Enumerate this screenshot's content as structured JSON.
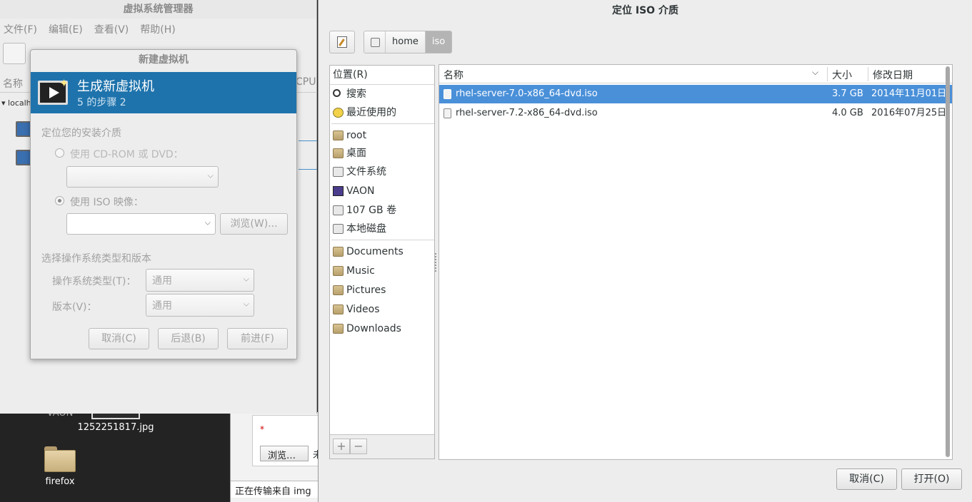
{
  "desktop": {
    "icons": [
      {
        "label": "VAON"
      },
      {
        "label": "1252251817.jpg"
      },
      {
        "label": "firefox"
      }
    ]
  },
  "browser": {
    "required_mark": "*",
    "browse_button": "浏览…",
    "trailing_text": "未",
    "status_text": "正在传输来自 img"
  },
  "vmm": {
    "title": "虚拟系统管理器",
    "menu": [
      "文件(F)",
      "编辑(E)",
      "查看(V)",
      "帮助(H)"
    ],
    "columns": {
      "name": "名称",
      "cpu": "CPU"
    },
    "connection": "localhost"
  },
  "new_vm": {
    "title": "新建虚拟机",
    "banner_title": "生成新虚拟机",
    "banner_step": "5 的步骤 2",
    "locate_label": "定位您的安装介质",
    "use_cdrom": "使用 CD-ROM 或 DVD：",
    "use_iso": "使用 ISO 映像：",
    "browse_button": "浏览(W)...",
    "os_section": "选择操作系统类型和版本",
    "os_type_label": "操作系统类型(T)：",
    "os_type_value": "通用",
    "version_label": "版本(V)：",
    "version_value": "通用",
    "cancel": "取消(C)",
    "back": "后退(B)",
    "forward": "前进(F)"
  },
  "chooser": {
    "title": "定位 ISO 介质",
    "breadcrumbs": [
      "home",
      "iso"
    ],
    "places_header": "位置(R)",
    "places": [
      {
        "label": "搜索",
        "icon": "search-icon"
      },
      {
        "label": "最近使用的",
        "icon": "recent-icon"
      },
      {
        "label": "root",
        "icon": "home-folder-icon"
      },
      {
        "label": "桌面",
        "icon": "desktop-folder-icon"
      },
      {
        "label": "文件系统",
        "icon": "drive-icon"
      },
      {
        "label": "VAON",
        "icon": "vaon-drive-icon"
      },
      {
        "label": "107 GB 卷",
        "icon": "drive-icon"
      },
      {
        "label": "本地磁盘",
        "icon": "drive-icon"
      },
      {
        "label": "Documents",
        "icon": "folder-icon"
      },
      {
        "label": "Music",
        "icon": "music-folder-icon"
      },
      {
        "label": "Pictures",
        "icon": "pictures-folder-icon"
      },
      {
        "label": "Videos",
        "icon": "videos-folder-icon"
      },
      {
        "label": "Downloads",
        "icon": "downloads-folder-icon"
      }
    ],
    "add": "+",
    "remove": "−",
    "columns": {
      "name": "名称",
      "size": "大小",
      "modified": "修改日期"
    },
    "files": [
      {
        "name": "rhel-server-7.0-x86_64-dvd.iso",
        "size": "3.7 GB",
        "modified": "2014年11月01日",
        "selected": true
      },
      {
        "name": "rhel-server-7.2-x86_64-dvd.iso",
        "size": "4.0 GB",
        "modified": "2016年07月25日",
        "selected": false
      }
    ],
    "cancel": "取消(C)",
    "open": "打开(O)"
  },
  "colors": {
    "selection": "#4a90d9",
    "banner": "#1e73ac"
  }
}
